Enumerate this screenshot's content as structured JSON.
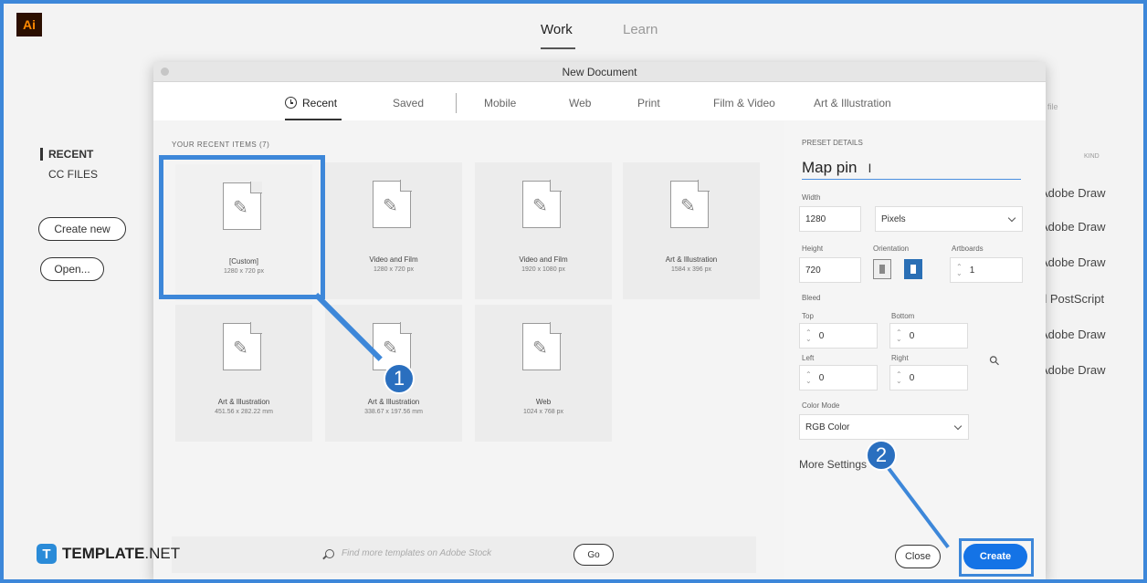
{
  "app": {
    "logo": "Ai"
  },
  "top_tabs": [
    {
      "label": "Work"
    },
    {
      "label": "Learn"
    }
  ],
  "left_nav": {
    "recent": "RECENT",
    "cc_files": "CC FILES",
    "create_new": "Create new",
    "open": "Open..."
  },
  "bg_list": {
    "partial_header": "file",
    "kind": "KIND",
    "rows": [
      "Adobe Draw",
      "Adobe Draw",
      "Adobe Draw",
      "d PostScript",
      "Adobe Draw",
      "Adobe Draw"
    ]
  },
  "dialog": {
    "title": "New Document",
    "tabs": [
      "Recent",
      "Saved",
      "Mobile",
      "Web",
      "Print",
      "Film & Video",
      "Art & Illustration"
    ],
    "recent_heading": "YOUR RECENT ITEMS (7)",
    "tiles": [
      {
        "name": "[Custom]",
        "size": "1280 x 720 px"
      },
      {
        "name": "Video and Film",
        "size": "1280 x 720 px"
      },
      {
        "name": "Video and Film",
        "size": "1920 x 1080 px"
      },
      {
        "name": "Art & Illustration",
        "size": "1584 x 396 px"
      },
      {
        "name": "Art & Illustration",
        "size": "451.56 x 282.22 mm"
      },
      {
        "name": "Art & Illustration",
        "size": "338.67 x 197.56 mm"
      },
      {
        "name": "Web",
        "size": "1024 x 768 px"
      }
    ],
    "search_placeholder": "Find more templates on Adobe Stock",
    "go_label": "Go"
  },
  "preset": {
    "heading": "PRESET DETAILS",
    "name": "Map pin",
    "width_label": "Width",
    "width": "1280",
    "units": "Pixels",
    "height_label": "Height",
    "height": "720",
    "orientation_label": "Orientation",
    "artboards_label": "Artboards",
    "artboards": "1",
    "bleed_label": "Bleed",
    "top_label": "Top",
    "top": "0",
    "bottom_label": "Bottom",
    "bottom": "0",
    "left_label": "Left",
    "left": "0",
    "right_label": "Right",
    "right": "0",
    "color_mode_label": "Color Mode",
    "color_mode": "RGB Color",
    "more_settings": "More Settings",
    "close_label": "Close",
    "create_label": "Create"
  },
  "annotations": {
    "step1": "1",
    "step2": "2",
    "accent_color": "#3d87d9"
  },
  "brand": {
    "logo": "T",
    "name_bold": "TEMPLATE",
    "name_light": ".NET"
  }
}
